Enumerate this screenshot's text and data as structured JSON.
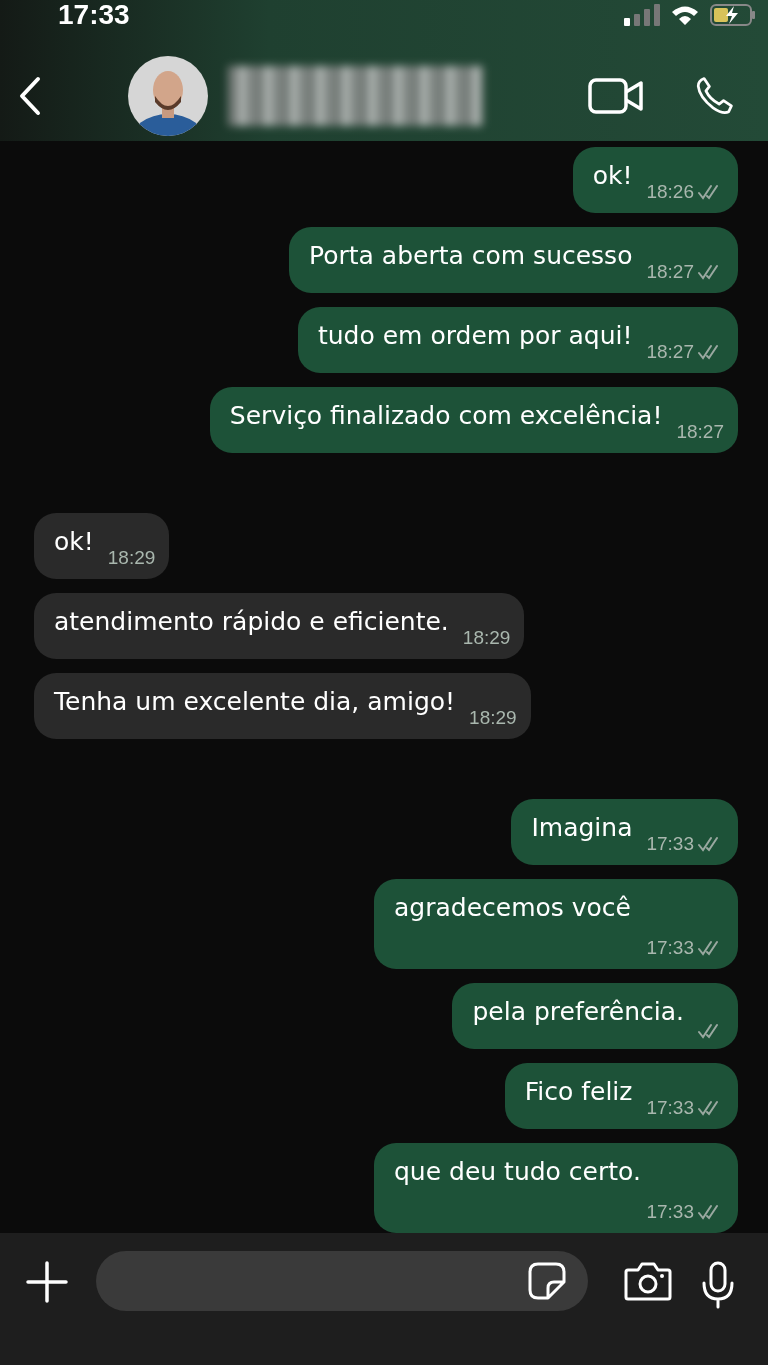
{
  "status_bar": {
    "time": "17:33"
  },
  "groups": [
    {
      "messages": [
        {
          "kind": "out",
          "text": "ok!",
          "time": "18:26",
          "ticks": true,
          "time_below": false
        },
        {
          "kind": "out",
          "text": "Porta aberta com sucesso",
          "time": "18:27",
          "ticks": true,
          "time_below": false
        },
        {
          "kind": "out",
          "text": "tudo em ordem por aqui!",
          "time": "18:27",
          "ticks": true,
          "time_below": false
        },
        {
          "kind": "out",
          "text": "Serviço finalizado com excelência!",
          "time": "18:27",
          "ticks": false,
          "time_below": false
        }
      ]
    },
    {
      "messages": [
        {
          "kind": "in",
          "text": "ok!",
          "time": "18:29",
          "ticks": false,
          "time_below": false
        },
        {
          "kind": "in",
          "text": "atendimento rápido e eficiente.",
          "time": "18:29",
          "ticks": false,
          "time_below": false
        },
        {
          "kind": "in",
          "text": "Tenha um excelente dia, amigo!",
          "time": "18:29",
          "ticks": false,
          "time_below": false
        }
      ]
    },
    {
      "messages": [
        {
          "kind": "out",
          "text": "Imagina",
          "time": "17:33",
          "ticks": true,
          "time_below": false
        },
        {
          "kind": "out",
          "text": "agradecemos você",
          "time": "17:33",
          "ticks": true,
          "time_below": true
        },
        {
          "kind": "out",
          "text": "pela preferência.",
          "ticks": true,
          "time_below": false
        },
        {
          "kind": "out",
          "text": "Fico feliz",
          "time": "17:33",
          "ticks": true,
          "time_below": false
        },
        {
          "kind": "out",
          "text": "que deu tudo certo.",
          "time": "17:33",
          "ticks": true,
          "time_below": true
        }
      ]
    }
  ]
}
